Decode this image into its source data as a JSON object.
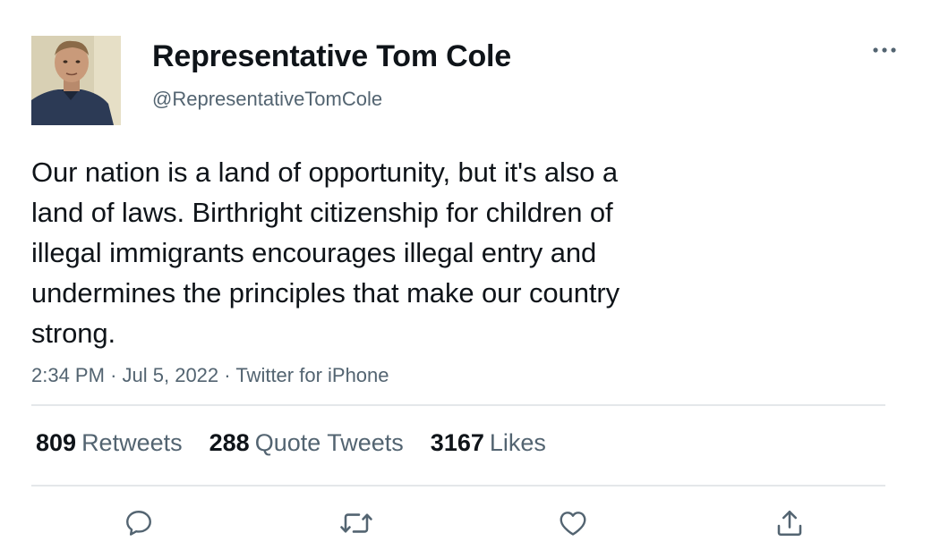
{
  "author": {
    "display_name": "Representative Tom Cole",
    "handle": "@RepresentativeTomCole",
    "avatar_icon": "profile-photo"
  },
  "more_icon": "more-dots-icon",
  "tweet": {
    "text": "Our nation is a land of opportunity, but it's also a\nland of laws. Birthright citizenship for children of\nillegal immigrants encourages illegal entry and\nundermines the principles that make our country\nstrong.",
    "time": "2:34 PM",
    "separator": "·",
    "date": "Jul 5, 2022",
    "source": "Twitter for iPhone"
  },
  "stats": {
    "retweets_count": "809",
    "retweets_label": "Retweets",
    "quotes_count": "288",
    "quotes_label": "Quote Tweets",
    "likes_count": "3167",
    "likes_label": "Likes"
  },
  "actions": [
    {
      "name": "reply",
      "icon": "comment-icon"
    },
    {
      "name": "retweet",
      "icon": "retweet-icon"
    },
    {
      "name": "like",
      "icon": "heart-icon"
    },
    {
      "name": "share",
      "icon": "share-icon"
    }
  ],
  "colors": {
    "text_primary": "#0f1419",
    "text_secondary": "#536471",
    "divider": "#e4e7ea",
    "icon": "#536471"
  }
}
